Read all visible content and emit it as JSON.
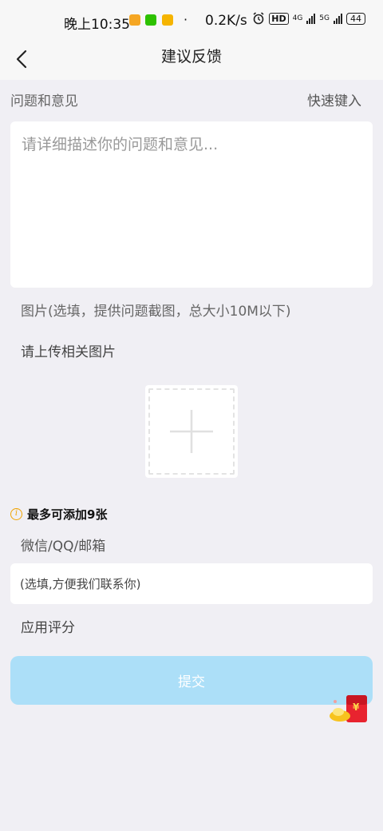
{
  "status_bar": {
    "time": "晚上10:35",
    "separator": "·",
    "net_speed": "0.2K/s",
    "hd_label": "HD",
    "sim1_label": "4G",
    "sim2_label": "5G",
    "battery": "44",
    "colors": {
      "app1": "#f5a623",
      "app2": "#2dc100",
      "app3": "#f5b400"
    }
  },
  "header": {
    "back_icon": "chevron-left-icon",
    "title": "建议反馈"
  },
  "feedback": {
    "label": "问题和意见",
    "quick_input": "快速键入",
    "placeholder": "请详细描述你的问题和意见...",
    "value": ""
  },
  "images": {
    "label": "图片(选填，提供问题截图，总大小10M以下)",
    "upload_prompt": "请上传相关图片",
    "add_icon": "plus-icon",
    "tip_icon": "info-icon",
    "tip": "最多可添加9张"
  },
  "contact": {
    "label": "微信/QQ/邮箱",
    "placeholder": "(选填,方便我们联系你)",
    "value": ""
  },
  "rating": {
    "label": "应用评分"
  },
  "submit": {
    "label": "提交",
    "color": "#acdff8"
  },
  "floating": {
    "icon": "red-packet-icon",
    "symbol": "¥"
  }
}
